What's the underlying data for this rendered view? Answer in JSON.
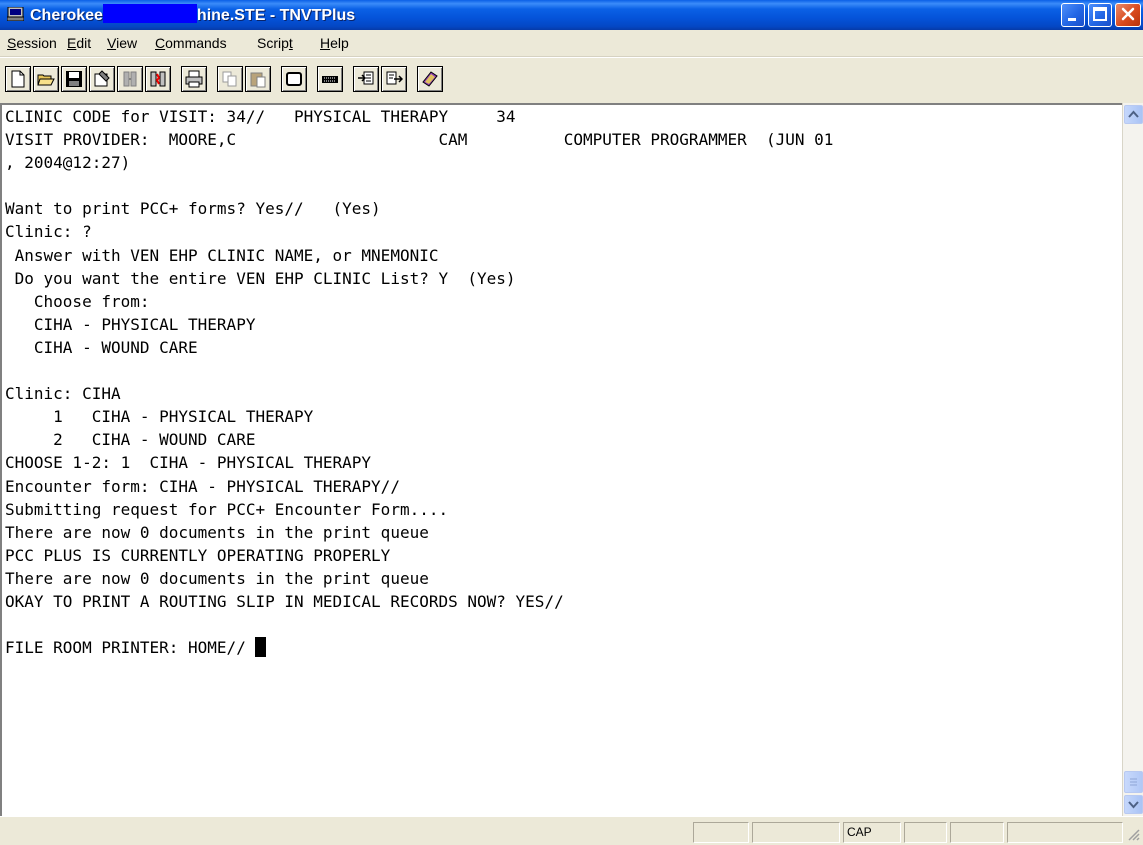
{
  "window": {
    "title_part1": "Cherokee",
    "title_part2": "hine.STE - TNVTPlus"
  },
  "menu": [
    {
      "first": "S",
      "rest": "ession"
    },
    {
      "first": "E",
      "rest": "dit"
    },
    {
      "first": "V",
      "rest": "iew"
    },
    {
      "first": "C",
      "rest": "ommands"
    },
    {
      "pre": "Scrip",
      "first": "t",
      "rest": ""
    },
    {
      "first": "H",
      "rest": "elp"
    }
  ],
  "toolbar_icons": [
    "new-icon",
    "open-icon",
    "save-icon",
    "properties-icon",
    "connect-icon",
    "disconnect-icon",
    "print-icon",
    "copy-icon",
    "paste-icon",
    "blank-screen-icon",
    "keyboard-icon",
    "import-icon",
    "export-icon",
    "help-book-icon"
  ],
  "terminal": {
    "lines": [
      "CLINIC CODE for VISIT: 34//   PHYSICAL THERAPY     34",
      "VISIT PROVIDER:  MOORE,C                     CAM          COMPUTER PROGRAMMER  (JUN 01",
      ", 2004@12:27)",
      "",
      "Want to print PCC+ forms? Yes//   (Yes)",
      "Clinic: ?",
      " Answer with VEN EHP CLINIC NAME, or MNEMONIC",
      " Do you want the entire VEN EHP CLINIC List? Y  (Yes)",
      "   Choose from:",
      "   CIHA - PHYSICAL THERAPY",
      "   CIHA - WOUND CARE",
      "",
      "Clinic: CIHA",
      "     1   CIHA - PHYSICAL THERAPY",
      "     2   CIHA - WOUND CARE",
      "CHOOSE 1-2: 1  CIHA - PHYSICAL THERAPY",
      "Encounter form: CIHA - PHYSICAL THERAPY//",
      "Submitting request for PCC+ Encounter Form....",
      "There are now 0 documents in the print queue",
      "PCC PLUS IS CURRENTLY OPERATING PROPERLY",
      "There are now 0 documents in the print queue",
      "OKAY TO PRINT A ROUTING SLIP IN MEDICAL RECORDS NOW? YES//",
      "",
      "FILE ROOM PRINTER: HOME// "
    ]
  },
  "status": {
    "caps": "CAP"
  },
  "colors": {
    "title_bar": "#0553d9",
    "redaction": "#0000ff",
    "terminal_bg": "#ffffff"
  }
}
